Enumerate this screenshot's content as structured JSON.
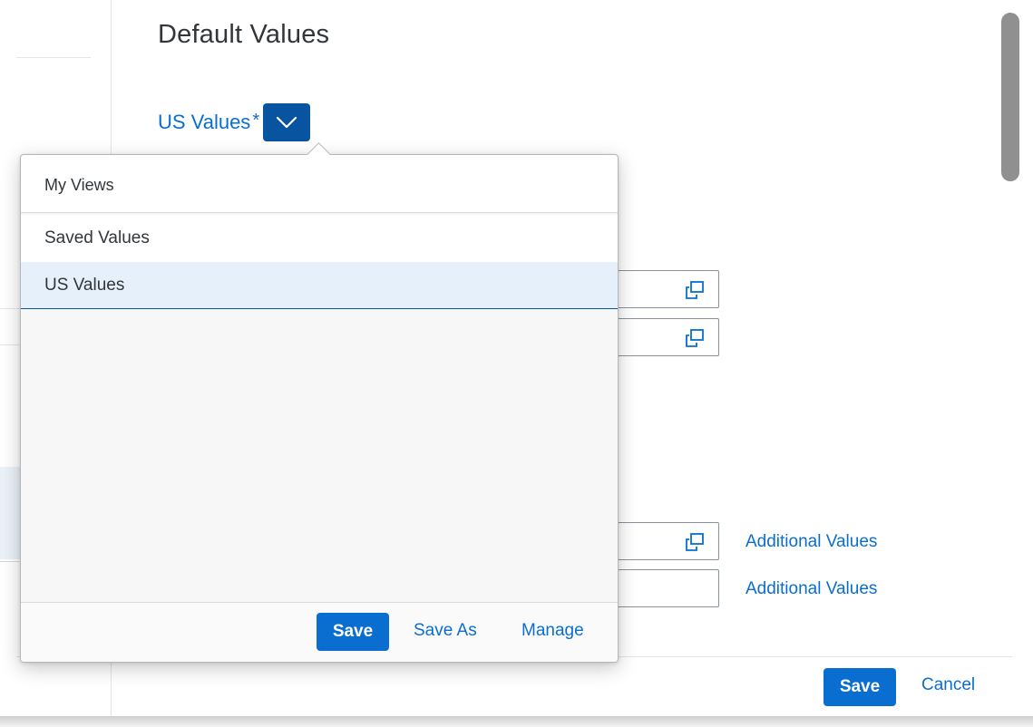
{
  "dialog": {
    "title": "Default Values",
    "variant": {
      "label": "US Values",
      "dirty_marker": "*",
      "icon": "chevron-down-icon"
    },
    "fields": [
      {
        "icon": "value-help-icon"
      },
      {
        "icon": "value-help-icon"
      },
      {
        "icon": "value-help-icon",
        "link": "Additional Values"
      },
      {
        "link": "Additional Values"
      }
    ],
    "footer": {
      "save_label": "Save",
      "cancel_label": "Cancel"
    }
  },
  "popover": {
    "title": "My Views",
    "items": [
      {
        "label": "Saved Values",
        "selected": false
      },
      {
        "label": "US Values",
        "selected": true
      }
    ],
    "footer": {
      "save_label": "Save",
      "save_as_label": "Save As",
      "manage_label": "Manage"
    }
  },
  "colors": {
    "accent": "#0a6ed1",
    "emphasized_button": "#0854a0",
    "selection_bg": "#e5f0fa",
    "text": "#32363a"
  }
}
